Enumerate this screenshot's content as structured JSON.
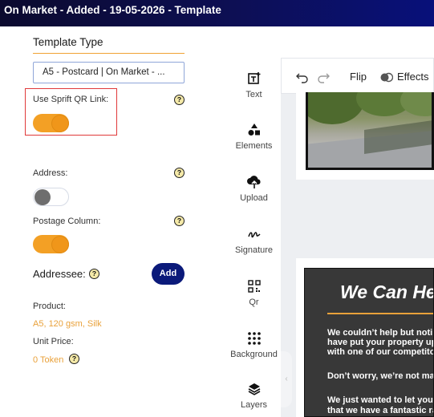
{
  "header": {
    "title": "On Market - Added - 19-05-2026 - Template"
  },
  "panel": {
    "section_title": "Template Type",
    "template_select_value": "A5 - Postcard | On Market - ...",
    "help_glyph": "?",
    "toggles": [
      {
        "label": "Use Sprift QR Link:",
        "on": true
      },
      {
        "label": "Address:",
        "on": false
      },
      {
        "label": "Postage Column:",
        "on": true
      }
    ],
    "addressee_label": "Addressee:",
    "add_button": "Add",
    "product_label": "Product:",
    "product_value": "A5, 120 gsm, Silk",
    "unit_price_label": "Unit Price:",
    "unit_price_value": "0 Token"
  },
  "tools": [
    {
      "label": "Text",
      "icon": "text-add-icon"
    },
    {
      "label": "Elements",
      "icon": "shapes-icon"
    },
    {
      "label": "Upload",
      "icon": "cloud-upload-icon"
    },
    {
      "label": "Signature",
      "icon": "signature-icon"
    },
    {
      "label": "Qr",
      "icon": "qr-code-icon"
    },
    {
      "label": "Background",
      "icon": "grid-dots-icon"
    },
    {
      "label": "Layers",
      "icon": "layers-icon"
    }
  ],
  "editor_toolbar": {
    "flip": "Flip",
    "effects": "Effects"
  },
  "postcard": {
    "headline": "We Can He",
    "paragraphs": [
      "We couldn’t help but noti",
      "have put your property up",
      "with one of our competito",
      "Don’t worry, we’re not ma",
      "We just wanted to let you",
      "that we have a fantastic ra"
    ]
  },
  "colors": {
    "accent": "#f3a025",
    "header_bg": "#0d0f55",
    "add_button_bg": "#0b1a7a",
    "highlight_box": "#e0393a"
  }
}
